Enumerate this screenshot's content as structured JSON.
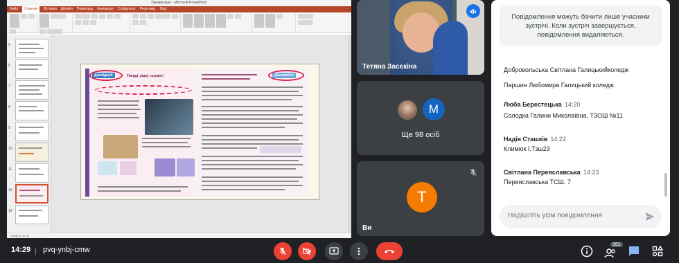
{
  "shared_screen": {
    "window_title": "Презентація - Microsoft PowerPoint",
    "ribbon_tabs": [
      "Файл",
      "Главная",
      "Вставка",
      "Дизайн",
      "Переходы",
      "Анимация",
      "Слайд-шоу",
      "Рецензир.",
      "Вид"
    ],
    "slide_left_tag": "Досліджуй",
    "slide_left_heading": "Тверді, рідкі, газуваті",
    "slide_right_tag": "Дізнавайся",
    "status_text": "Слайд 10 из 15"
  },
  "participants": {
    "main_speaker": "Тетяна Засєкіна",
    "others_avatar_letter": "M",
    "others_label": "Ще 98 осіб",
    "self_avatar_letter": "T",
    "self_label": "Ви"
  },
  "chat": {
    "notice": "Повідомлення можуть бачити лише учасники зустрічі. Коли зустріч завершується, повідомлення видаляються.",
    "messages": [
      {
        "sender": "",
        "time": "",
        "text": "Добровольська Світлана Галицькийколедж"
      },
      {
        "sender": "",
        "time": "",
        "text": "Паршин Любомира Галицький коледж"
      },
      {
        "sender": "Люба Берестецька",
        "time": "14:20",
        "text": "Солодка Галини Миколаївна, ТЗОШ №11"
      },
      {
        "sender": "Надія Сташків",
        "time": "14:22",
        "text": "Климюк І.Тзш23"
      },
      {
        "sender": "Світлана Переяславська",
        "time": "14:23",
        "text": "Переяславська ТСШ. 7"
      }
    ],
    "input_placeholder": "Надішліть усім повідомлення"
  },
  "bottom_bar": {
    "time": "14:29",
    "meeting_code": "pvq-ynbj-cmw",
    "participants_count": "101"
  },
  "colors": {
    "background": "#202124",
    "danger": "#ea4335",
    "accent": "#1a73e8"
  }
}
